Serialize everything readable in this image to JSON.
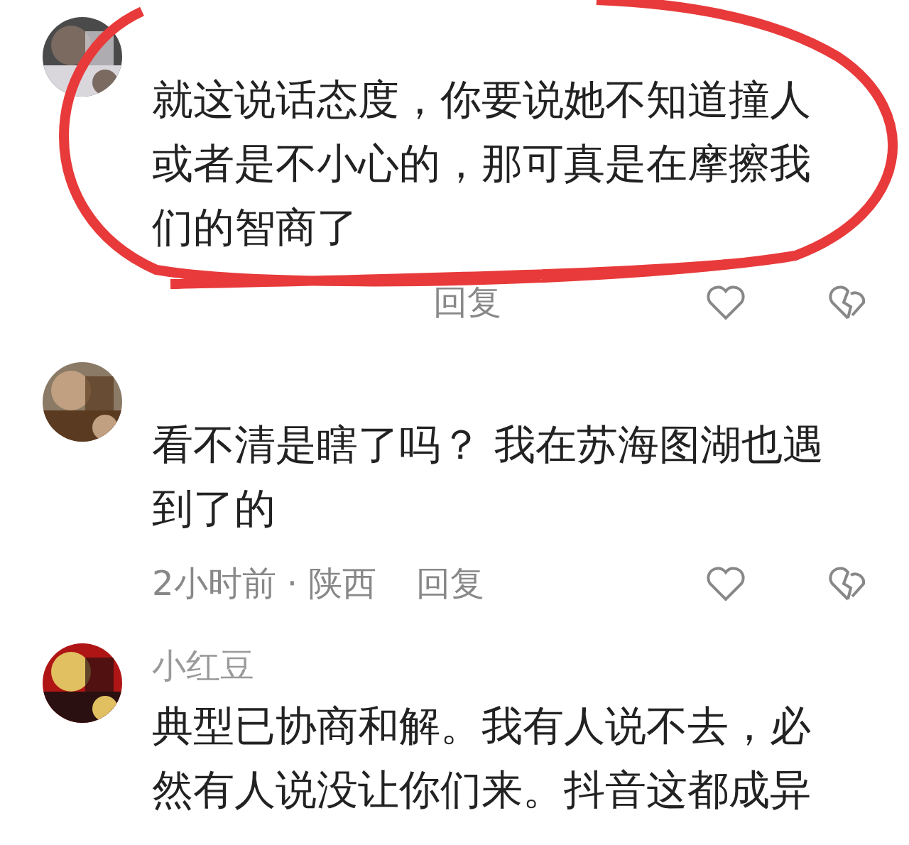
{
  "comments": [
    {
      "text_lines": [
        "就这说话态度，你要说她不知道撞人",
        "或者是不小心的，那可真是在摩擦我",
        "们的智商了"
      ],
      "reply": "回复",
      "highlighted": true
    },
    {
      "text_lines": [
        "看不清是瞎了吗？ 我在苏海图湖也遇",
        "到了的"
      ],
      "time": "2小时前 · 陕西",
      "reply": "回复",
      "highlighted": false
    },
    {
      "username": "小红豆",
      "text_lines": [
        "典型已协商和解。我有人说不去，必",
        "然有人说没让你们来。抖音这都成异"
      ],
      "highlighted": false
    }
  ]
}
